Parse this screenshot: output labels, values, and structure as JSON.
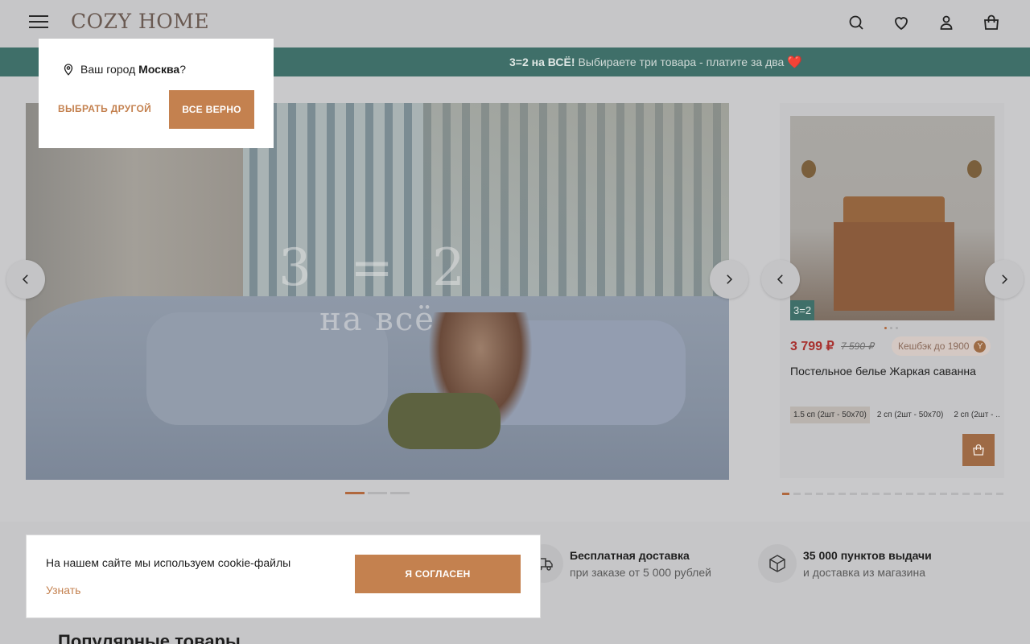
{
  "header": {
    "logo": "COZY HOME",
    "icons": [
      "menu-icon",
      "search-icon",
      "heart-icon",
      "user-icon",
      "bag-icon"
    ]
  },
  "promo": {
    "bold": "3=2 на ВСЁ!",
    "text": "Выбираете три товара - платите за два",
    "emoji": "❤️"
  },
  "hero": {
    "headline": "3 = 2",
    "subline": "на всё",
    "slides": 3,
    "active_slide": 1
  },
  "product": {
    "badge": "3=2",
    "price": "3 799 ₽",
    "old_price": "7 590 ₽",
    "cashback": "Кешбэк до 1900",
    "cashback_icon_letter": "Y",
    "title": "Постельное белье Жаркая саванна",
    "sizes": [
      "1.5 сп (2шт - 50x70)",
      "2 сп (2шт - 50x70)",
      "2 сп (2шт - ..."
    ],
    "selected_size": 0,
    "image_dots": 3,
    "carousel_dots": 20,
    "active_carousel_dot": 1
  },
  "features": [
    {
      "title": "Бесплатная доставка",
      "subtitle": "при заказе от 5 000 рублей",
      "icon": "truck-icon"
    },
    {
      "title": "35 000 пунктов выдачи",
      "subtitle": "и доставка из магазина",
      "icon": "box-icon"
    }
  ],
  "section": {
    "title": "Популярные товары"
  },
  "city_popup": {
    "question_prefix": "Ваш город",
    "city": "Москва",
    "question_suffix": "?",
    "other_label": "ВЫБРАТЬ ДРУГОЙ",
    "confirm_label": "ВСЕ ВЕРНО"
  },
  "cookie": {
    "message": "На нашем сайте мы используем cookie-файлы",
    "learn_label": "Узнать",
    "agree_label": "Я СОГЛАСЕН"
  },
  "colors": {
    "accent": "#c4814f",
    "promo_bg": "#3f6f69",
    "price": "#a8302e"
  }
}
